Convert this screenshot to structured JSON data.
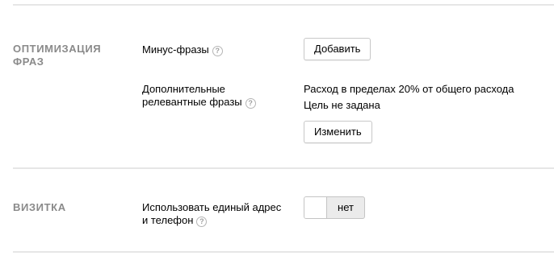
{
  "sections": {
    "optimization": {
      "title_line1": "ОПТИМИЗАЦИЯ",
      "title_line2": "ФРАЗ",
      "minus_phrases": {
        "label": "Минус-фразы",
        "button": "Добавить"
      },
      "additional_phrases": {
        "label_line1": "Дополнительные",
        "label_line2": "релевантные фразы",
        "info_line1": "Расход в пределах 20% от общего расхода",
        "info_line2": "Цель не задана",
        "button": "Изменить"
      }
    },
    "vcard": {
      "title": "ВИЗИТКА",
      "single_address": {
        "label_line1": "Использовать единый адрес",
        "label_line2": "и телефон",
        "toggle_value": "нет"
      }
    }
  },
  "icons": {
    "help": "?"
  }
}
